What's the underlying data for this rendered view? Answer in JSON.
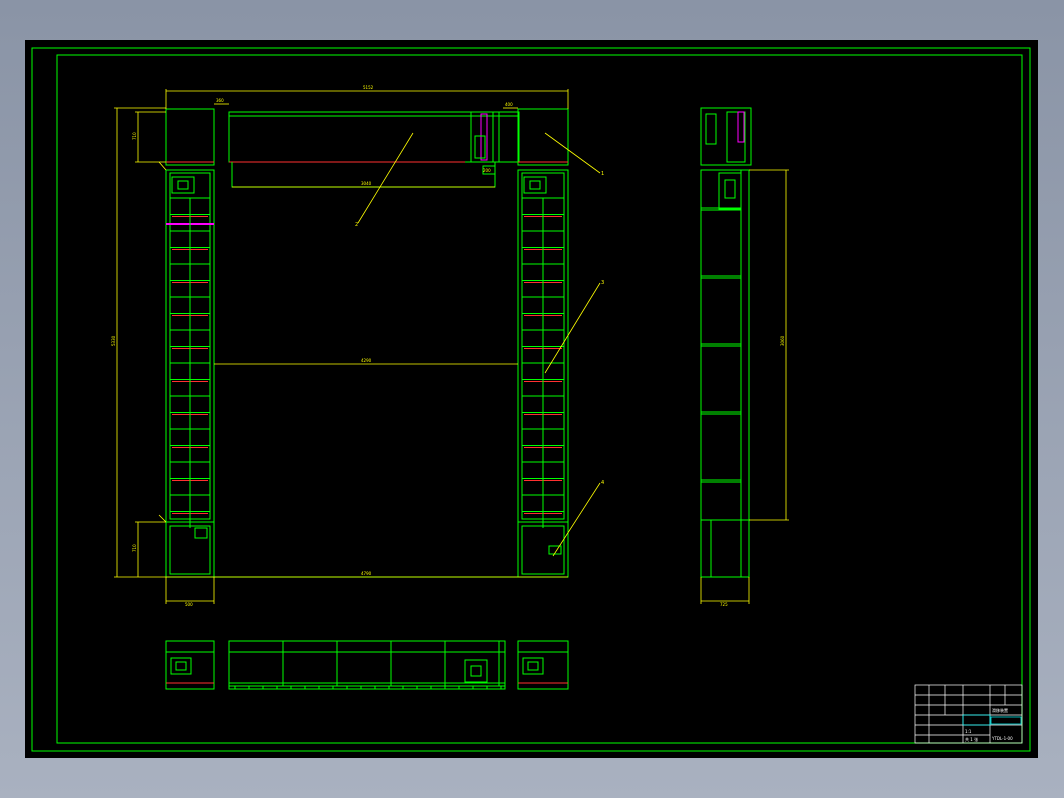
{
  "drawing": {
    "background": "#000000",
    "colors": {
      "frame": "#00ff00",
      "structure": "#00ff00",
      "dimension": "#ffff00",
      "rail": "#ff3030",
      "accent": "#ff00ff",
      "title_text": "#ffffff",
      "cyan": "#00ffff"
    },
    "dimensions": {
      "top_overall": "5152",
      "top_inner": "3040",
      "top_block": "710",
      "mid_span": "4290",
      "bottom_span": "4790",
      "left_height": "5330",
      "left_bottom": "710",
      "left_width_bottom": "500",
      "right_height": "3060",
      "side_width_bottom": "725",
      "small_top_left": "360",
      "small_top_right": "400",
      "small_gear": "200"
    },
    "callouts": [
      "1",
      "2",
      "3",
      "4"
    ],
    "title_block": {
      "title": "滑移装置",
      "drawing_no": "YTDL-1-00",
      "scale": "1:1",
      "sheet": "共 1 张"
    }
  }
}
